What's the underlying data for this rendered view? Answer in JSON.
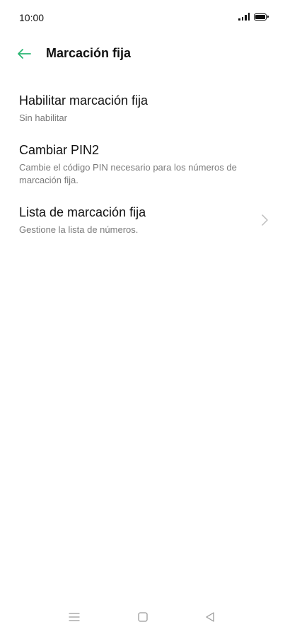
{
  "status_bar": {
    "time": "10:00",
    "icons": [
      "signal-icon",
      "battery-icon"
    ]
  },
  "app_bar": {
    "back_icon": "arrow-left-icon",
    "title": "Marcación fija",
    "accent_color": "#2bb673"
  },
  "settings": [
    {
      "title": "Habilitar marcación fija",
      "subtitle": "Sin habilitar",
      "has_chevron": false
    },
    {
      "title": "Cambiar PIN2",
      "subtitle": "Cambie el código PIN necesario para los números de marcación fija.",
      "has_chevron": false
    },
    {
      "title": "Lista de marcación fija",
      "subtitle": "Gestione la lista de números.",
      "has_chevron": true,
      "chevron_icon": "chevron-right-icon"
    }
  ],
  "nav_bar": {
    "icons": [
      "menu-icon",
      "home-square-icon",
      "back-triangle-icon"
    ]
  }
}
